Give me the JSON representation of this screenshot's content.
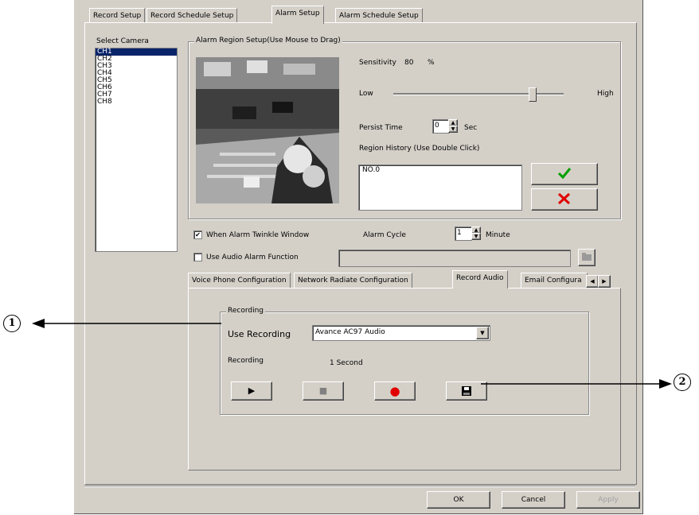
{
  "tabs": [
    "Record Setup",
    "Record Schedule Setup",
    "Alarm Setup",
    "Alarm Schedule Setup"
  ],
  "select_camera": {
    "label": "Select Camera",
    "items": [
      "CH1",
      "CH2",
      "CH3",
      "CH4",
      "CH5",
      "CH6",
      "CH7",
      "CH8"
    ]
  },
  "region": {
    "group_label": "Alarm Region Setup(Use Mouse to Drag)",
    "sensitivity_label": "Sensitivity",
    "sensitivity_value": "80",
    "sensitivity_unit": "%",
    "low_label": "Low",
    "high_label": "High",
    "persist_label": "Persist Time",
    "persist_value": "0",
    "persist_unit": "Sec",
    "history_label": "Region History (Use Double Click)",
    "history_items": [
      "NO.0"
    ]
  },
  "alarm": {
    "twinkle_label": "When Alarm Twinkle Window",
    "twinkle_checked": "✔",
    "cycle_label": "Alarm Cycle",
    "cycle_value": "1",
    "cycle_unit": "Minute",
    "audio_label": "Use Audio Alarm Function"
  },
  "subtabs": [
    "Voice Phone Configuration",
    "Network Radiate Configuration",
    "Record Audio",
    "Email Configura"
  ],
  "recording": {
    "group_label": "Recording",
    "use_label": "Use Recording",
    "device": "Avance AC97 Audio",
    "status_label": "Recording",
    "duration": "1 Second",
    "play_icon": "▶",
    "stop_icon": "■",
    "record_icon": "●",
    "save_icon": "floppy-disk"
  },
  "footer": {
    "ok": "OK",
    "cancel": "Cancel",
    "apply": "Apply"
  },
  "callouts": {
    "one": "1",
    "two": "2"
  }
}
